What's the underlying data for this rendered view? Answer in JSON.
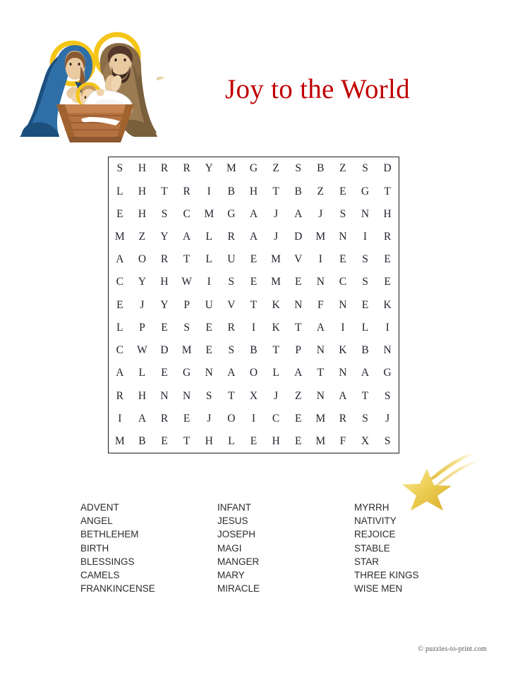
{
  "page": {
    "title": "Joy to the World",
    "title_color": "#c00000",
    "background_color": "#ffffff",
    "footer_credit": "© puzzles-to-print.com"
  },
  "artwork": {
    "nativity": {
      "name": "nativity-scene",
      "description": "Nativity scene with Mary, Joseph, baby Jesus in manger",
      "colors": {
        "mary_robe": "#2f6fa8",
        "mary_robe_dark": "#1d4f7c",
        "joseph_robe": "#9a7b52",
        "joseph_robe_dark": "#7a5f3c",
        "halo": "#f5c518",
        "manger": "#b5713f",
        "manger_dark": "#8d5730",
        "skin": "#e8c9a0",
        "cloth": "#ffffff"
      }
    },
    "shooting_star": {
      "name": "shooting-star",
      "description": "Golden five-pointed star with trailing tail",
      "colors": {
        "star": "#e8c23a",
        "star_light": "#f7e08a",
        "tail": "#edd15e"
      }
    }
  },
  "grid": {
    "rows": 13,
    "cols": 13,
    "border_color": "#1a1a1a",
    "letters": [
      [
        "S",
        "H",
        "R",
        "R",
        "Y",
        "M",
        "G",
        "Z",
        "S",
        "B",
        "Z",
        "S",
        "D"
      ],
      [
        "L",
        "H",
        "T",
        "R",
        "I",
        "B",
        "H",
        "T",
        "B",
        "Z",
        "E",
        "G",
        "T"
      ],
      [
        "E",
        "H",
        "S",
        "C",
        "M",
        "G",
        "A",
        "J",
        "A",
        "J",
        "S",
        "N",
        "H"
      ],
      [
        "M",
        "Z",
        "Y",
        "A",
        "L",
        "R",
        "A",
        "J",
        "D",
        "M",
        "N",
        "I",
        "R"
      ],
      [
        "A",
        "O",
        "R",
        "T",
        "L",
        "U",
        "E",
        "M",
        "V",
        "I",
        "E",
        "S",
        "E"
      ],
      [
        "C",
        "Y",
        "H",
        "W",
        "I",
        "S",
        "E",
        "M",
        "E",
        "N",
        "C",
        "S",
        "E"
      ],
      [
        "E",
        "J",
        "Y",
        "P",
        "U",
        "V",
        "T",
        "K",
        "N",
        "F",
        "N",
        "E",
        "K"
      ],
      [
        "L",
        "P",
        "E",
        "S",
        "E",
        "R",
        "I",
        "K",
        "T",
        "A",
        "I",
        "L",
        "I"
      ],
      [
        "C",
        "W",
        "D",
        "M",
        "E",
        "S",
        "B",
        "T",
        "P",
        "N",
        "K",
        "B",
        "N"
      ],
      [
        "A",
        "L",
        "E",
        "G",
        "N",
        "A",
        "O",
        "L",
        "A",
        "T",
        "N",
        "A",
        "G"
      ],
      [
        "R",
        "H",
        "N",
        "N",
        "S",
        "T",
        "X",
        "J",
        "Z",
        "N",
        "A",
        "T",
        "S"
      ],
      [
        "I",
        "A",
        "R",
        "E",
        "J",
        "O",
        "I",
        "C",
        "E",
        "M",
        "R",
        "S",
        "J"
      ],
      [
        "M",
        "B",
        "E",
        "T",
        "H",
        "L",
        "E",
        "H",
        "E",
        "M",
        "F",
        "X",
        "S"
      ]
    ]
  },
  "word_list": {
    "columns": [
      {
        "words": [
          "ADVENT",
          "ANGEL",
          "BETHLEHEM",
          "BIRTH",
          "BLESSINGS",
          "CAMELS",
          "FRANKINCENSE"
        ]
      },
      {
        "words": [
          "INFANT",
          "JESUS",
          "JOSEPH",
          "MAGI",
          "MANGER",
          "MARY",
          "MIRACLE"
        ]
      },
      {
        "words": [
          "MYRRH",
          "NATIVITY",
          "REJOICE",
          "STABLE",
          "STAR",
          "THREE KINGS",
          "WISE MEN"
        ]
      }
    ]
  }
}
